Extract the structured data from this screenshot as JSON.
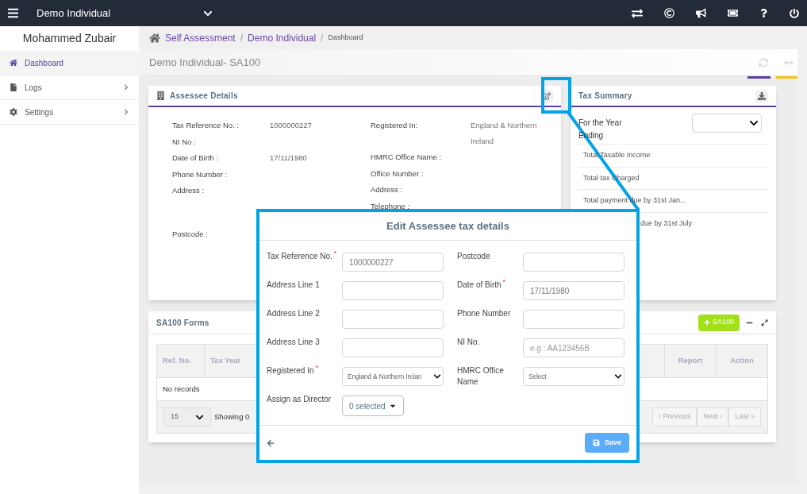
{
  "topbar": {
    "title": "Demo Individual"
  },
  "sidebar": {
    "user": "Mohammed Zubair",
    "items": [
      {
        "label": "Dashboard",
        "selected": true,
        "has_children": false,
        "kind": "home"
      },
      {
        "label": "Logs",
        "selected": false,
        "has_children": true,
        "kind": "file"
      },
      {
        "label": "Settings",
        "selected": false,
        "has_children": true,
        "kind": "gear"
      }
    ]
  },
  "breadcrumb": [
    {
      "kind": "link",
      "text": "Self Assessment"
    },
    {
      "kind": "separator",
      "text": "/"
    },
    {
      "kind": "link",
      "text": "Demo Individual"
    },
    {
      "kind": "separator",
      "text": "/"
    },
    {
      "kind": "current",
      "text": "Dashboard"
    }
  ],
  "page_title": "Demo Individual- SA100",
  "assessee_details": {
    "title": "Assessee Details",
    "left": [
      {
        "label": "Tax Reference No. :",
        "value": "1000000227"
      },
      {
        "label": "NI No :"
      },
      {
        "label": "Date of Birth :",
        "value": "17/11/1980"
      },
      {
        "label": "Phone Number :"
      },
      {
        "label": "Address :"
      },
      {
        "label": "Postcode :"
      }
    ],
    "right": [
      {
        "label": "Registered In:",
        "value": "England & Northern Ireland"
      },
      {
        "label": "HMRC Office Name :"
      },
      {
        "label": "Office Number :"
      },
      {
        "label": "Address :"
      },
      {
        "label": "Telephone :"
      }
    ]
  },
  "tax_summary": {
    "title": "Tax Summary",
    "year_label": "For the Year Ending",
    "rows": [
      "Total Taxable Income",
      "Total tax Charged",
      "Total payment due by 31st Jan...",
      "due by 31st July"
    ]
  },
  "sa100_forms": {
    "title": "SA100 Forms",
    "add_button": "SA100",
    "columns": [
      "Ref. No.",
      "Tax Year",
      "Report",
      "Action"
    ],
    "empty": "No records",
    "page_size": "15",
    "showing": "Showing 0",
    "pager": [
      "‹ Previous",
      "Next ›",
      "Last »"
    ]
  },
  "modal": {
    "title": "Edit Assessee tax details",
    "left": [
      {
        "label": "Tax Reference No.",
        "required_mark": "*",
        "kind": "text",
        "value": "1000000227"
      },
      {
        "label": "Address Line 1",
        "kind": "text"
      },
      {
        "label": "Address Line 2",
        "kind": "text"
      },
      {
        "label": "Address Line 3",
        "kind": "text"
      },
      {
        "label": "Registered In",
        "required_mark": "*",
        "kind": "select",
        "value": "England & Northern Irelan"
      },
      {
        "label": "Assign as Director",
        "kind": "multiselect",
        "value": "0 selected"
      }
    ],
    "right": [
      {
        "label": "Postcode",
        "kind": "text"
      },
      {
        "label": "Date of Birth",
        "required_mark": "*",
        "kind": "text",
        "value": "17/11/1980"
      },
      {
        "label": "Phone Number",
        "kind": "text"
      },
      {
        "label": "NI No.",
        "kind": "text",
        "placeholder": "e.g : AA123456B"
      },
      {
        "label": "HMRC Office Name",
        "kind": "select",
        "value": "Select"
      }
    ],
    "save": "Save"
  }
}
